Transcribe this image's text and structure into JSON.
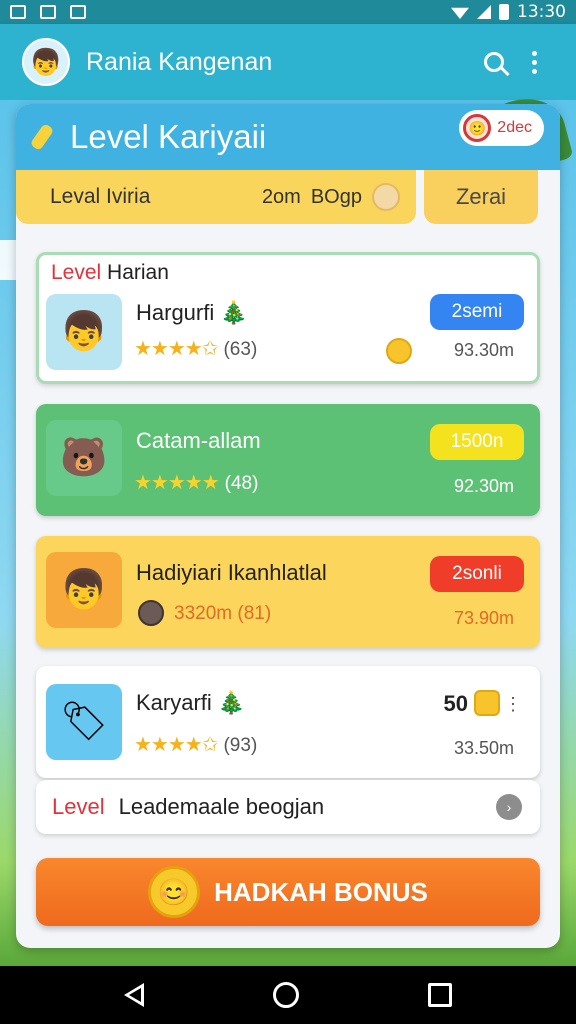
{
  "status_bar": {
    "time": "13:30"
  },
  "app_bar": {
    "title": "Rania Kangenan"
  },
  "main": {
    "header_title": "Level Kariyaii",
    "header_badge": "2dec",
    "tabs": [
      {
        "label": "Leval Iviria",
        "extra": "2om",
        "extra2": "BOgp"
      },
      {
        "label": "Zerai"
      }
    ],
    "section_label_red": "Level",
    "section_label_rest": " Harian",
    "games": [
      {
        "name": "Hargurfi 🎄",
        "stars": "★★★★✩",
        "count": "(63)",
        "pill": "2semi",
        "meta": "93.30m",
        "pill_color": "#3484f1",
        "bg": "#ffffff"
      },
      {
        "name": "Catam-allam",
        "stars": "★★★★★",
        "count": "(48)",
        "pill": "1500n",
        "meta": "92.30m",
        "pill_color": "#f5e21f",
        "bg": "#5cc175"
      },
      {
        "name": "Hadiyiari Ikanhlatlal",
        "stars": "",
        "count": "3320m (81)",
        "pill": "2sonli",
        "meta": "73.90m",
        "pill_color": "#f03d2a",
        "bg": "#fbd55c"
      },
      {
        "name": "Karyarfi 🎄",
        "stars": "★★★★✩",
        "count": "(93)",
        "pill": "50",
        "meta": "33.50m",
        "pill_color": "#ffffff",
        "bg": "#ffffff"
      }
    ],
    "leader_red": "Level",
    "leader_text": "Leademaale beogjan",
    "bonus_label": "HADKAH BONUS"
  }
}
